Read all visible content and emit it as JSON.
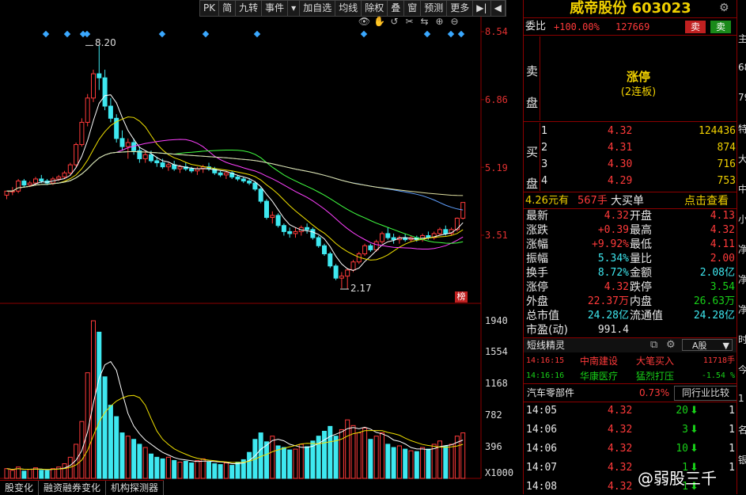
{
  "toolbar": [
    "PK",
    "简",
    "九转",
    "事件",
    "▾",
    "加自选",
    "均线",
    "除权",
    "叠",
    "窗",
    "预测",
    "更多",
    "▶|",
    "◀"
  ],
  "chart_icons": [
    "👁",
    "✋",
    "↺",
    "✂",
    "⇆",
    "⊕",
    "⊖"
  ],
  "price_axis": [
    "8.54",
    "6.86",
    "5.19",
    "3.51"
  ],
  "volume_axis": [
    "1940",
    "1554",
    "1168",
    "782",
    "396",
    "X1000"
  ],
  "high_label": "8.20",
  "low_label": "2.17",
  "rank_badge": "榜",
  "bottom_tabs": [
    "股变化",
    "融资融券变化",
    "机构探测器"
  ],
  "stock": {
    "name": "威帝股份",
    "code": "603023"
  },
  "weibi": {
    "label": "委比",
    "pct": "+100.00%",
    "diff": "127669",
    "sell_btn": "卖",
    "buy_btn": "卖"
  },
  "sell_side": {
    "label": "卖盘",
    "status": "涨停",
    "sub": "(2连板)"
  },
  "buy_side": {
    "label": "买盘",
    "levels": [
      {
        "n": "1",
        "price": "4.32",
        "vol": "124436"
      },
      {
        "n": "2",
        "price": "4.31",
        "vol": "874"
      },
      {
        "n": "3",
        "price": "4.30",
        "vol": "716"
      },
      {
        "n": "4",
        "price": "4.29",
        "vol": "753"
      }
    ]
  },
  "big_buy": {
    "price": "4.26元有",
    "lots": "567手",
    "label": "大买单",
    "link": "点击查看"
  },
  "quote": [
    {
      "l1": "最新",
      "v1": "4.32",
      "c1": "red",
      "l2": "开盘",
      "v2": "4.13",
      "c2": "red"
    },
    {
      "l1": "涨跌",
      "v1": "+0.39",
      "c1": "red",
      "l2": "最高",
      "v2": "4.32",
      "c2": "red"
    },
    {
      "l1": "涨幅",
      "v1": "+9.92%",
      "c1": "red",
      "l2": "最低",
      "v2": "4.11",
      "c2": "red"
    },
    {
      "l1": "振幅",
      "v1": "5.34%",
      "c1": "cyan",
      "l2": "量比",
      "v2": "2.00",
      "c2": "red"
    },
    {
      "l1": "换手",
      "v1": "8.72%",
      "c1": "cyan",
      "l2": "金额",
      "v2": "2.08亿",
      "c2": "cyan"
    },
    {
      "l1": "涨停",
      "v1": "4.32",
      "c1": "red",
      "l2": "跌停",
      "v2": "3.54",
      "c2": "green"
    },
    {
      "l1": "外盘",
      "v1": "22.37万",
      "c1": "red",
      "l2": "内盘",
      "v2": "26.63万",
      "c2": "green"
    },
    {
      "l1": "总市值",
      "v1": "24.28亿",
      "c1": "cyan",
      "l2": "流通值",
      "v2": "24.28亿",
      "c2": "cyan"
    },
    {
      "l1": "市盈(动)",
      "v1": "991.4",
      "c1": "white",
      "l2": "",
      "v2": "",
      "c2": "white"
    }
  ],
  "sprite": {
    "title": "短线精灵",
    "mode": "A股",
    "rows": [
      {
        "time": "14:16:15",
        "name": "中南建设",
        "event": "大笔买入",
        "val": "11718手",
        "color": "red"
      },
      {
        "time": "14:16:16",
        "name": "华康医疗",
        "event": "猛烈打压",
        "val": "-1.54 %",
        "color": "green"
      }
    ]
  },
  "sector": {
    "name": "汽车零部件",
    "pct": "0.73%",
    "btn": "同行业比较"
  },
  "ticks": [
    {
      "time": "14:05",
      "price": "4.32",
      "vol": "20",
      "dir": "down",
      "flag": "1"
    },
    {
      "time": "14:06",
      "price": "4.32",
      "vol": "3",
      "dir": "down",
      "flag": "1"
    },
    {
      "time": "14:06",
      "price": "4.32",
      "vol": "10",
      "dir": "down",
      "flag": "1"
    },
    {
      "time": "14:07",
      "price": "4.32",
      "vol": "1",
      "dir": "down",
      "flag": "1"
    },
    {
      "time": "14:08",
      "price": "4.32",
      "vol": "1",
      "dir": "down",
      "flag": ""
    }
  ],
  "edge_text": [
    "主",
    "68",
    "79",
    "特",
    "大",
    "中",
    "小",
    "净",
    "净",
    "净",
    "时",
    "今",
    "1",
    "名",
    "银"
  ],
  "watermark": "@弱股三千",
  "colors": {
    "up": "#ff3a3a",
    "down": "#3ee8f0",
    "accent": "#f0d000",
    "border": "#8b0000"
  },
  "chart_data": {
    "type": "candlestick",
    "price_axis_ticks": [
      8.54,
      6.86,
      5.19,
      3.51
    ],
    "high": 8.2,
    "low": 2.17,
    "candles": [
      [
        4.5,
        4.6,
        4.4,
        4.6
      ],
      [
        4.6,
        4.7,
        4.5,
        4.6
      ],
      [
        4.6,
        4.9,
        4.55,
        4.85
      ],
      [
        4.85,
        4.9,
        4.7,
        4.75
      ],
      [
        4.75,
        4.85,
        4.7,
        4.8
      ],
      [
        4.8,
        4.95,
        4.75,
        4.9
      ],
      [
        4.9,
        5.0,
        4.8,
        4.85
      ],
      [
        4.85,
        4.9,
        4.75,
        4.8
      ],
      [
        4.8,
        4.95,
        4.75,
        4.9
      ],
      [
        4.9,
        5.0,
        4.85,
        4.95
      ],
      [
        4.95,
        5.1,
        4.9,
        5.05
      ],
      [
        5.05,
        5.3,
        5.0,
        5.25
      ],
      [
        5.25,
        5.8,
        5.2,
        5.75
      ],
      [
        5.75,
        6.4,
        5.7,
        6.3
      ],
      [
        6.3,
        7.0,
        6.2,
        6.9
      ],
      [
        6.9,
        7.6,
        6.8,
        7.5
      ],
      [
        7.5,
        8.2,
        7.1,
        7.4
      ],
      [
        7.4,
        7.6,
        6.6,
        6.7
      ],
      [
        6.7,
        6.9,
        6.3,
        6.4
      ],
      [
        6.4,
        6.5,
        5.8,
        5.9
      ],
      [
        5.9,
        6.1,
        5.6,
        5.7
      ],
      [
        5.7,
        5.9,
        5.4,
        5.8
      ],
      [
        5.8,
        5.9,
        5.5,
        5.6
      ],
      [
        5.6,
        5.7,
        5.3,
        5.4
      ],
      [
        5.4,
        5.6,
        5.3,
        5.5
      ],
      [
        5.5,
        5.6,
        5.3,
        5.35
      ],
      [
        5.35,
        5.45,
        5.2,
        5.3
      ],
      [
        5.3,
        5.4,
        5.15,
        5.2
      ],
      [
        5.2,
        5.3,
        5.1,
        5.25
      ],
      [
        5.25,
        5.35,
        5.1,
        5.15
      ],
      [
        5.15,
        5.25,
        5.05,
        5.2
      ],
      [
        5.2,
        5.3,
        5.1,
        5.15
      ],
      [
        5.15,
        5.2,
        5.05,
        5.1
      ],
      [
        5.1,
        5.2,
        5.0,
        5.15
      ],
      [
        5.15,
        5.25,
        5.05,
        5.2
      ],
      [
        5.2,
        5.3,
        5.1,
        5.15
      ],
      [
        5.15,
        5.2,
        5.0,
        5.05
      ],
      [
        5.05,
        5.1,
        4.95,
        5.0
      ],
      [
        5.0,
        5.1,
        4.9,
        5.05
      ],
      [
        5.05,
        5.1,
        4.9,
        4.95
      ],
      [
        4.95,
        5.0,
        4.85,
        4.9
      ],
      [
        4.9,
        4.95,
        4.8,
        4.85
      ],
      [
        4.85,
        4.9,
        4.75,
        4.8
      ],
      [
        4.8,
        4.85,
        4.6,
        4.65
      ],
      [
        4.65,
        4.7,
        4.3,
        4.35
      ],
      [
        4.35,
        4.4,
        3.9,
        3.95
      ],
      [
        3.95,
        4.1,
        3.8,
        4.0
      ],
      [
        4.0,
        4.05,
        3.7,
        3.75
      ],
      [
        3.75,
        3.8,
        3.5,
        3.6
      ],
      [
        3.6,
        3.7,
        3.45,
        3.55
      ],
      [
        3.55,
        3.7,
        3.45,
        3.6
      ],
      [
        3.6,
        3.75,
        3.5,
        3.7
      ],
      [
        3.7,
        3.8,
        3.55,
        3.65
      ],
      [
        3.65,
        3.7,
        3.4,
        3.45
      ],
      [
        3.45,
        3.5,
        3.2,
        3.25
      ],
      [
        3.25,
        3.3,
        3.0,
        3.05
      ],
      [
        3.05,
        3.1,
        2.7,
        2.75
      ],
      [
        2.75,
        2.8,
        2.4,
        2.45
      ],
      [
        2.45,
        2.6,
        2.2,
        2.5
      ],
      [
        2.5,
        2.7,
        2.17,
        2.65
      ],
      [
        2.65,
        2.9,
        2.6,
        2.85
      ],
      [
        2.85,
        3.1,
        2.8,
        3.05
      ],
      [
        3.05,
        3.3,
        3.0,
        3.25
      ],
      [
        3.25,
        3.3,
        3.1,
        3.15
      ],
      [
        3.15,
        3.4,
        3.1,
        3.35
      ],
      [
        3.35,
        3.6,
        3.3,
        3.55
      ],
      [
        3.55,
        3.7,
        3.4,
        3.45
      ],
      [
        3.45,
        3.55,
        3.3,
        3.4
      ],
      [
        3.4,
        3.5,
        3.3,
        3.45
      ],
      [
        3.45,
        3.55,
        3.35,
        3.4
      ],
      [
        3.4,
        3.5,
        3.35,
        3.45
      ],
      [
        3.45,
        3.5,
        3.35,
        3.4
      ],
      [
        3.4,
        3.55,
        3.35,
        3.5
      ],
      [
        3.5,
        3.6,
        3.4,
        3.45
      ],
      [
        3.45,
        3.6,
        3.4,
        3.55
      ],
      [
        3.55,
        3.7,
        3.5,
        3.65
      ],
      [
        3.65,
        3.75,
        3.5,
        3.55
      ],
      [
        3.55,
        3.7,
        3.5,
        3.65
      ],
      [
        3.65,
        3.95,
        3.6,
        3.93
      ],
      [
        3.93,
        4.32,
        3.9,
        4.32
      ]
    ],
    "volumes": [
      120,
      100,
      140,
      90,
      110,
      130,
      100,
      95,
      120,
      140,
      180,
      260,
      420,
      700,
      1300,
      1940,
      1800,
      1250,
      900,
      760,
      560,
      520,
      480,
      420,
      380,
      300,
      260,
      240,
      260,
      220,
      200,
      210,
      190,
      220,
      240,
      200,
      180,
      170,
      190,
      160,
      200,
      230,
      320,
      480,
      560,
      450,
      520,
      400,
      380,
      350,
      360,
      420,
      390,
      460,
      520,
      580,
      640,
      520,
      600,
      720,
      650,
      560,
      620,
      480,
      520,
      560,
      420,
      380,
      400,
      360,
      340,
      330,
      380,
      360,
      420,
      460,
      400,
      420,
      520,
      560
    ]
  }
}
